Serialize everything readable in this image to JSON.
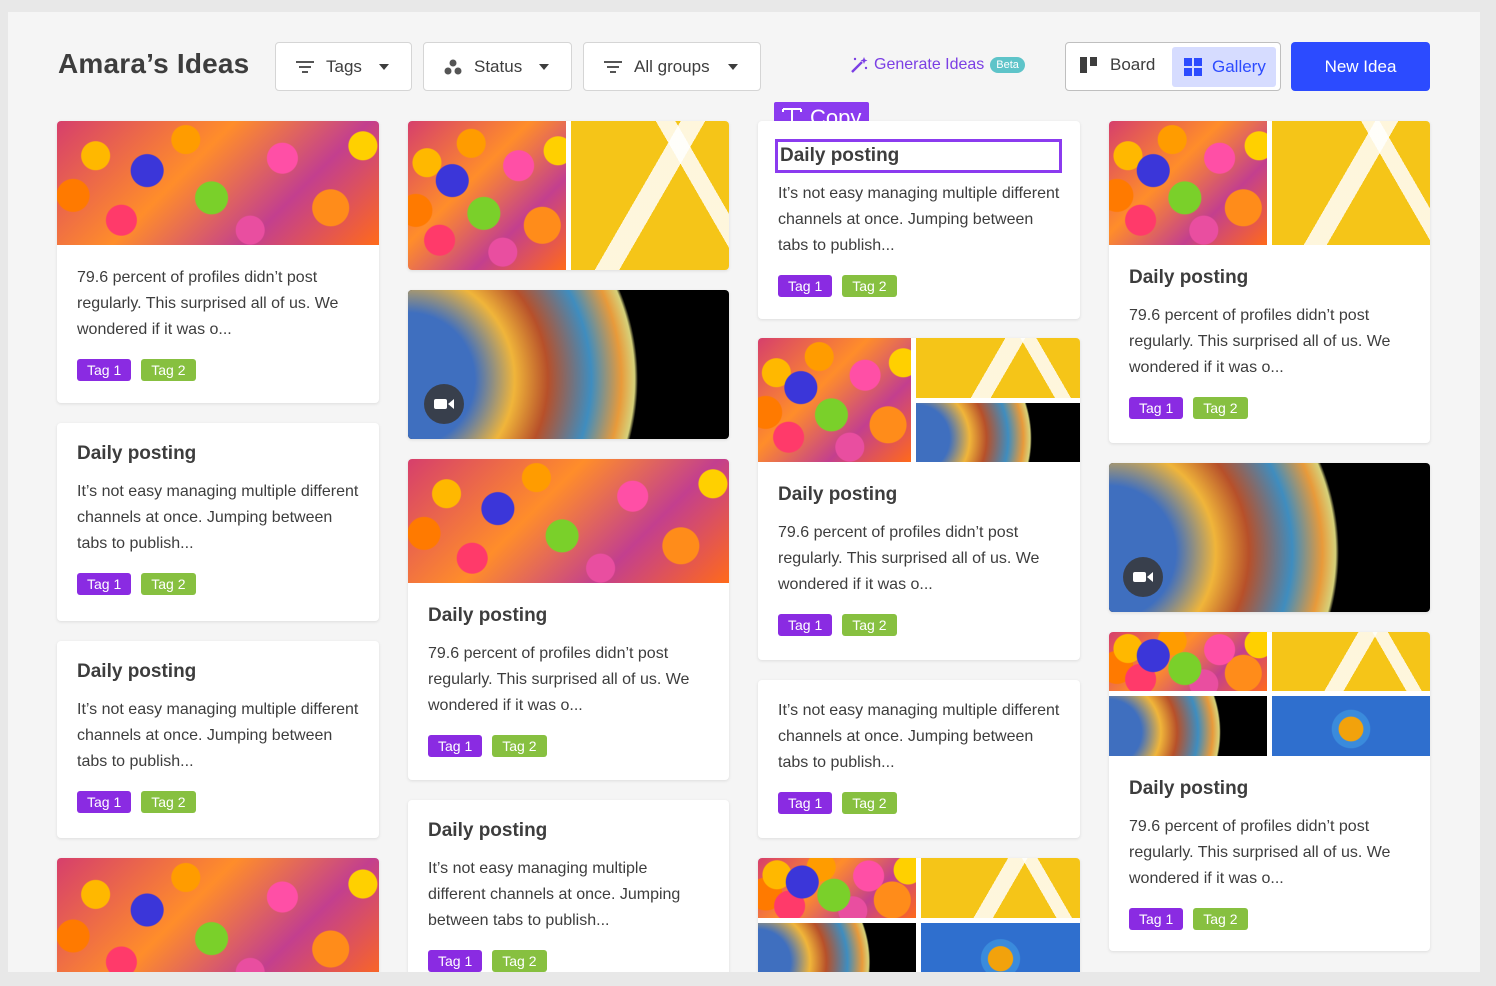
{
  "header": {
    "title": "Amara’s Ideas",
    "filters": [
      {
        "label": "Tags",
        "icon": "filter-lines-icon"
      },
      {
        "label": "Status",
        "icon": "status-dots-icon"
      },
      {
        "label": "All groups",
        "icon": "filter-lines-icon"
      }
    ],
    "generate_label": "Generate Ideas",
    "beta_label": "Beta",
    "view_board_label": "Board",
    "view_gallery_label": "Gallery",
    "selected_view": "Gallery",
    "new_idea_label": "New Idea"
  },
  "colors": {
    "accent": "#2c4bff",
    "purple": "#8b3bef",
    "tag1": "#8a2be2",
    "tag2": "#87c040"
  },
  "editor": {
    "copy_label": "Copy",
    "copy_icon": "text-t-icon"
  },
  "cards": {
    "c1": {
      "desc": "79.6 percent of profiles didn’t post regularly. This surprised all of us. We wondered if it was o...",
      "tag1": "Tag 1",
      "tag2": "Tag 2"
    },
    "c2": {
      "title": "Daily posting",
      "desc": "It’s not easy managing multiple different channels at once. Jumping between tabs to publish...",
      "tag1": "Tag 1",
      "tag2": "Tag 2"
    },
    "c3": {
      "title": "Daily posting",
      "desc": "It’s not easy managing multiple different channels at once. Jumping between tabs to publish...",
      "tag1": "Tag 1",
      "tag2": "Tag 2"
    },
    "c6": {
      "title": "Daily posting",
      "desc": "79.6 percent of profiles didn’t post regularly. This surprised all of us. We wondered if it was o...",
      "tag1": "Tag 1",
      "tag2": "Tag 2"
    },
    "c7": {
      "title": "Daily posting",
      "desc": "It’s not easy managing multiple different channels at once. Jumping between tabs to publish...",
      "tag1": "Tag 1",
      "tag2": "Tag 2"
    },
    "c8": {
      "title": "Daily posting",
      "desc": "It’s not easy managing multiple different channels at once. Jumping between tabs to publish...",
      "tag1": "Tag 1",
      "tag2": "Tag 2"
    },
    "c9": {
      "title": "Daily posting",
      "desc": "79.6 percent of profiles didn’t post regularly. This surprised all of us. We wondered if it was o...",
      "tag1": "Tag 1",
      "tag2": "Tag 2"
    },
    "c10": {
      "desc": "It’s not easy managing multiple different channels at once. Jumping between tabs to publish...",
      "tag1": "Tag 1",
      "tag2": "Tag 2"
    },
    "c12": {
      "title": "Daily posting",
      "desc": "79.6 percent of profiles didn’t post regularly. This surprised all of us. We wondered if it was o...",
      "tag1": "Tag 1",
      "tag2": "Tag 2"
    },
    "c14": {
      "title": "Daily posting",
      "desc": "79.6 percent of profiles didn’t post regularly. This surprised all of us. We wondered if it was o...",
      "tag1": "Tag 1",
      "tag2": "Tag 2"
    }
  }
}
